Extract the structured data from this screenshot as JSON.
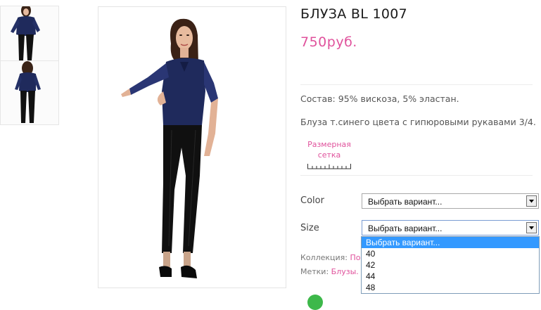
{
  "product": {
    "title": "БЛУЗА BL 1007",
    "price": "750руб.",
    "composition": "Состав: 95% вискоза, 5% эластан.",
    "description": "Блуза т.синего цвета с гипюровыми рукавами 3/4.",
    "size_chart_label": "Размерная сетка"
  },
  "options": {
    "color": {
      "label": "Color",
      "value": "Выбрать вариант..."
    },
    "size": {
      "label": "Size",
      "value": "Выбрать вариант...",
      "dropdown": [
        "Выбрать вариант...",
        "40",
        "42",
        "44",
        "48"
      ]
    }
  },
  "meta": {
    "collection_label": "Коллекция:",
    "collection_value": "По",
    "tags_label": "Метки:",
    "tags_value": "Блузы."
  },
  "colors": {
    "accent": "#e0529c",
    "blouse": "#1f2a5c",
    "dropdown_highlight": "#3399ff"
  },
  "icons": [
    "ruler-icon",
    "chevron-down-icon"
  ]
}
